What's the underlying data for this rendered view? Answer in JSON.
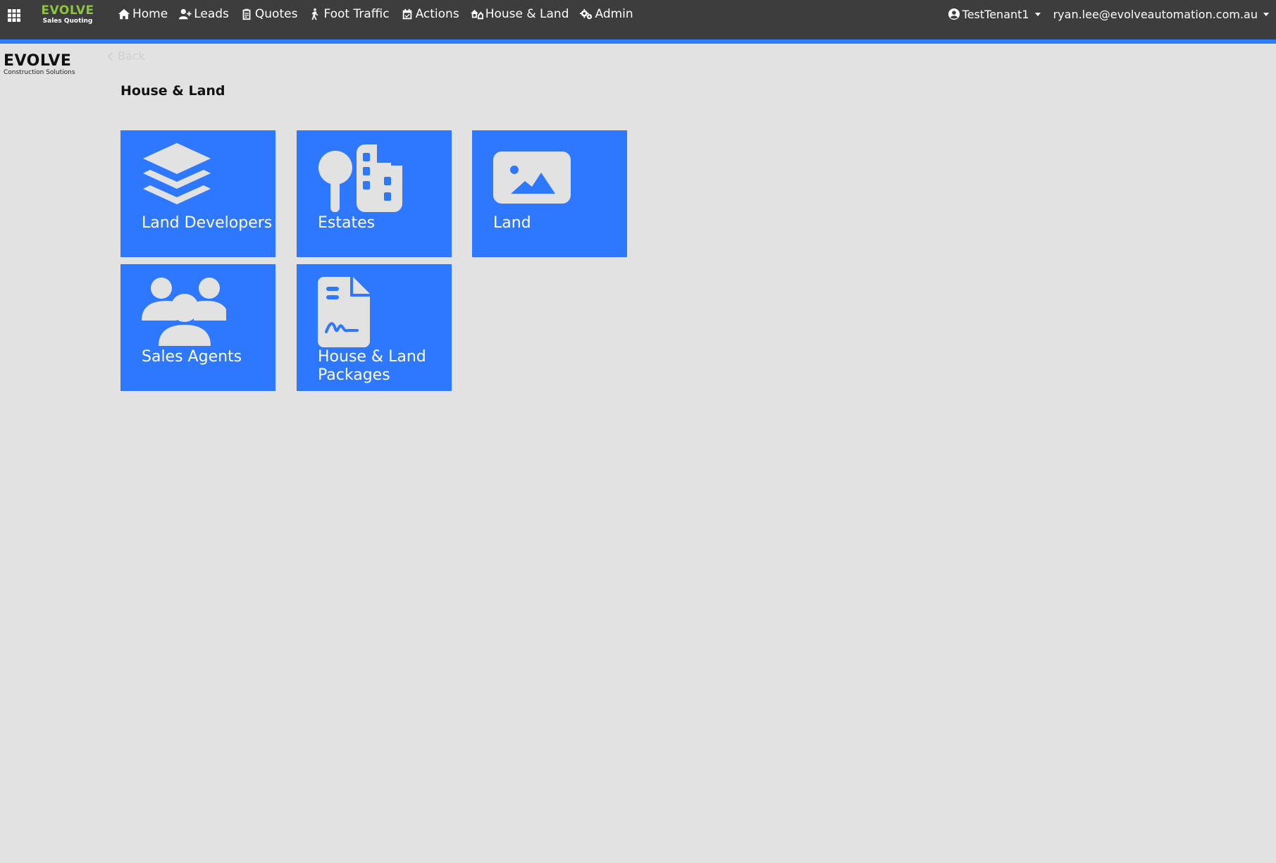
{
  "brand": {
    "name": "EVOLVE",
    "subtitle": "Sales Quoting"
  },
  "nav": {
    "items": [
      {
        "label": "Home",
        "icon": "home-icon"
      },
      {
        "label": "Leads",
        "icon": "user-plus-icon"
      },
      {
        "label": "Quotes",
        "icon": "clipboard-icon"
      },
      {
        "label": "Foot Traffic",
        "icon": "walking-icon"
      },
      {
        "label": "Actions",
        "icon": "calendar-check-icon"
      },
      {
        "label": "House & Land",
        "icon": "house-land-icon"
      },
      {
        "label": "Admin",
        "icon": "gears-icon"
      }
    ],
    "tenant": "TestTenant1",
    "user_email": "ryan.lee@evolveautomation.com.au"
  },
  "side_logo": {
    "name": "EVOLVE",
    "subtitle": "Construction Solutions"
  },
  "back_label": "Back",
  "page_title": "House & Land",
  "tiles": [
    {
      "label": "Land Developers",
      "icon": "layers-icon"
    },
    {
      "label": "Estates",
      "icon": "estate-buildings-icon"
    },
    {
      "label": "Land",
      "icon": "landscape-image-icon"
    },
    {
      "label": "Sales Agents",
      "icon": "users-group-icon"
    },
    {
      "label_line1": "House & Land",
      "label_line2": "Packages",
      "icon": "signed-document-icon"
    }
  ],
  "colors": {
    "navbar": "#3d3d3d",
    "accent": "#2e7bff",
    "tile": "#2e78ff",
    "brand_green": "#8cc63f",
    "background": "#e2e2e2"
  }
}
